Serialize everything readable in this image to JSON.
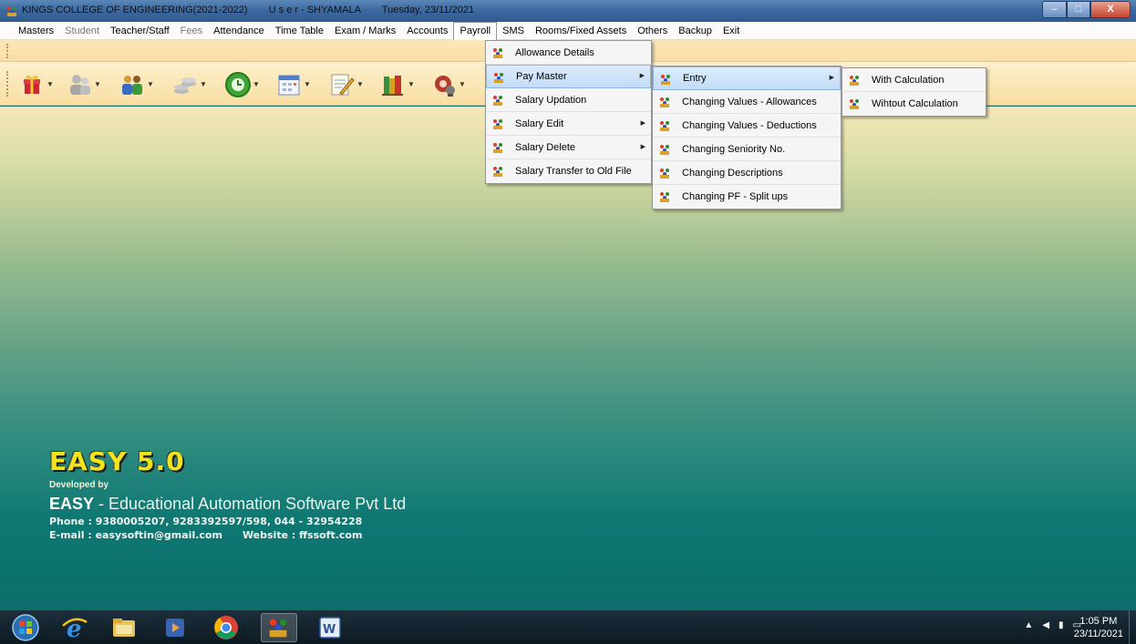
{
  "window": {
    "title_parts": [
      "KINGS COLLEGE OF ENGINEERING(2021-2022)",
      "U s e r - SHYAMALA",
      "Tuesday, 23/11/2021"
    ],
    "minimize": "–",
    "maximize": "□",
    "close": "X"
  },
  "menubar": {
    "items": [
      "Masters",
      "Student",
      "Teacher/Staff",
      "Fees",
      "Attendance",
      "Time Table",
      "Exam / Marks",
      "Accounts",
      "Payroll",
      "SMS",
      "Rooms/Fixed Assets",
      "Others",
      "Backup",
      "Exit"
    ]
  },
  "payroll_menu": {
    "items": [
      "Allowance Details",
      "Pay Master",
      "Salary Updation",
      "Salary Edit",
      "Salary Delete",
      "Salary Transfer to Old File"
    ]
  },
  "paymaster_menu": {
    "items": [
      "Entry",
      "Changing Values - Allowances",
      "Changing Values - Deductions",
      "Changing Seniority No.",
      "Changing Descriptions",
      "Changing PF - Split ups"
    ]
  },
  "entry_menu": {
    "items": [
      "With Calculation",
      "Wihtout Calculation"
    ]
  },
  "brand": {
    "product": "EASY 5.0",
    "developed_by": "Developed by",
    "company_bold": "EASY",
    "company_rest": " - Educational Automation Software Pvt Ltd",
    "phone": "Phone : 9380005207, 9283392597/598,  044 - 32954228",
    "email": "E-mail : easysoftin@gmail.com",
    "website": "Website : ffssoft.com"
  },
  "taskbar": {
    "time": "1:05 PM",
    "date": "23/11/2021"
  },
  "colors": {
    "brand_yellow": "#f2e31a",
    "menu_highlight": "#c3dcf7"
  }
}
